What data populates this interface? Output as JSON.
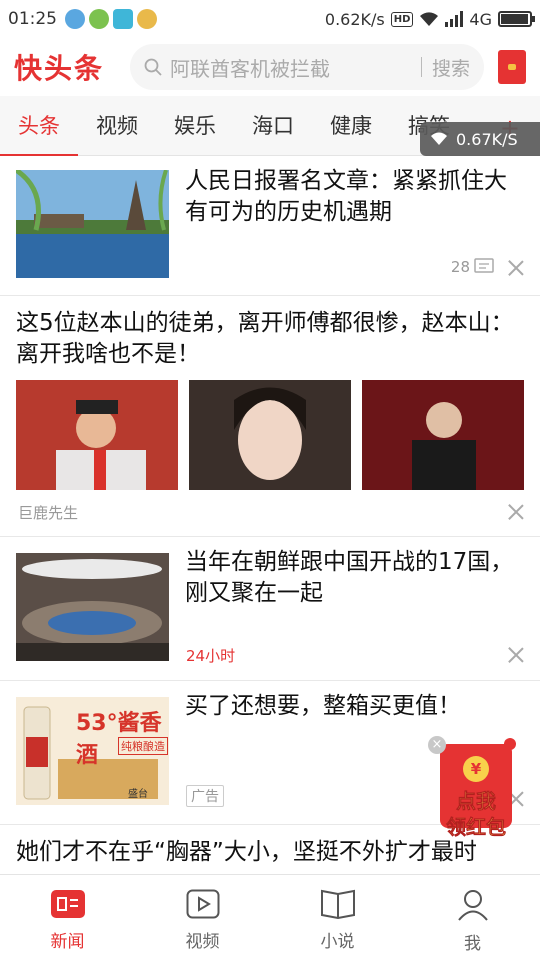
{
  "status_bar": {
    "time": "01:25",
    "speed": "0.62K/s",
    "hd": "HD",
    "network": "4G",
    "battery_level": 0.9
  },
  "header": {
    "logo": "快头条",
    "search_placeholder": "阿联酋客机被拦截",
    "search_button": "搜索"
  },
  "tabs": [
    {
      "label": "头条",
      "active": true
    },
    {
      "label": "视频"
    },
    {
      "label": "娱乐"
    },
    {
      "label": "海口"
    },
    {
      "label": "健康"
    },
    {
      "label": "搞笑"
    }
  ],
  "tab_add": "+",
  "speed_toast": "0.67K/S",
  "feed": [
    {
      "title": "人民日报署名文章：紧紧抓住大有可为的历史机遇期",
      "comments": "28"
    },
    {
      "title": "这5位赵本山的徒弟，离开师傅都很惨，赵本山：离开我啥也不是！",
      "source": "巨鹿先生"
    },
    {
      "title": "当年在朝鲜跟中国开战的17国，刚又聚在一起",
      "time": "24小时"
    },
    {
      "title": "买了还想要，整箱买更值！",
      "ad_label": "广告",
      "ad_image_text": "53°酱香酒",
      "ad_image_sub": "纯粮酿造",
      "ad_image_brand": "盛台"
    },
    {
      "title": "她们才不在乎“胸器”大小，坚挺不外扩才最时"
    }
  ],
  "float_red_packet": {
    "coin": "¥",
    "label_line1": "点我",
    "label_line2": "领红包"
  },
  "bottom_nav": [
    {
      "label": "新闻",
      "active": true,
      "icon": "news-icon"
    },
    {
      "label": "视频",
      "icon": "video-icon"
    },
    {
      "label": "小说",
      "icon": "book-icon"
    },
    {
      "label": "我",
      "icon": "profile-icon"
    }
  ],
  "colors": {
    "accent": "#e53333",
    "muted": "#999999"
  }
}
